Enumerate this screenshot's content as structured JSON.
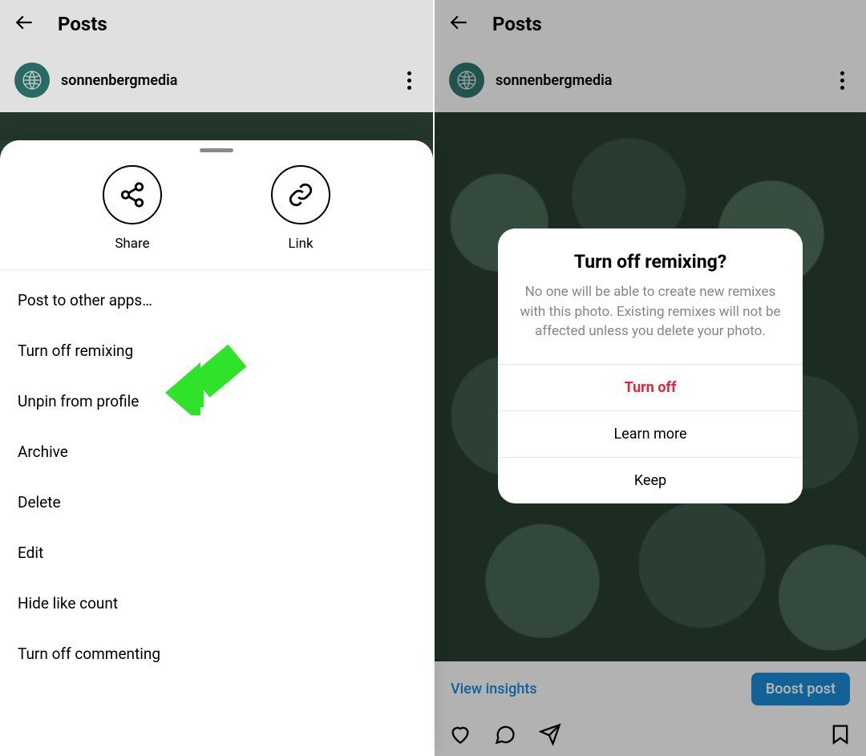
{
  "left": {
    "title": "Posts",
    "username": "sonnenbergmedia",
    "share_label": "Share",
    "link_label": "Link",
    "menu": [
      "Post to other apps…",
      "Turn off remixing",
      "Unpin from profile",
      "Archive",
      "Delete",
      "Edit",
      "Hide like count",
      "Turn off commenting"
    ]
  },
  "right": {
    "title": "Posts",
    "username": "sonnenbergmedia",
    "view_insights": "View insights",
    "boost": "Boost post",
    "dialog": {
      "title": "Turn off remixing?",
      "body": "No one will be able to create new remixes with this photo. Existing remixes will not be affected unless you delete your photo.",
      "turn_off": "Turn off",
      "learn_more": "Learn more",
      "keep": "Keep"
    }
  },
  "colors": {
    "accent_blue": "#1a8cd8",
    "danger_red": "#e4243c",
    "arrow_green": "#2fe22a"
  }
}
